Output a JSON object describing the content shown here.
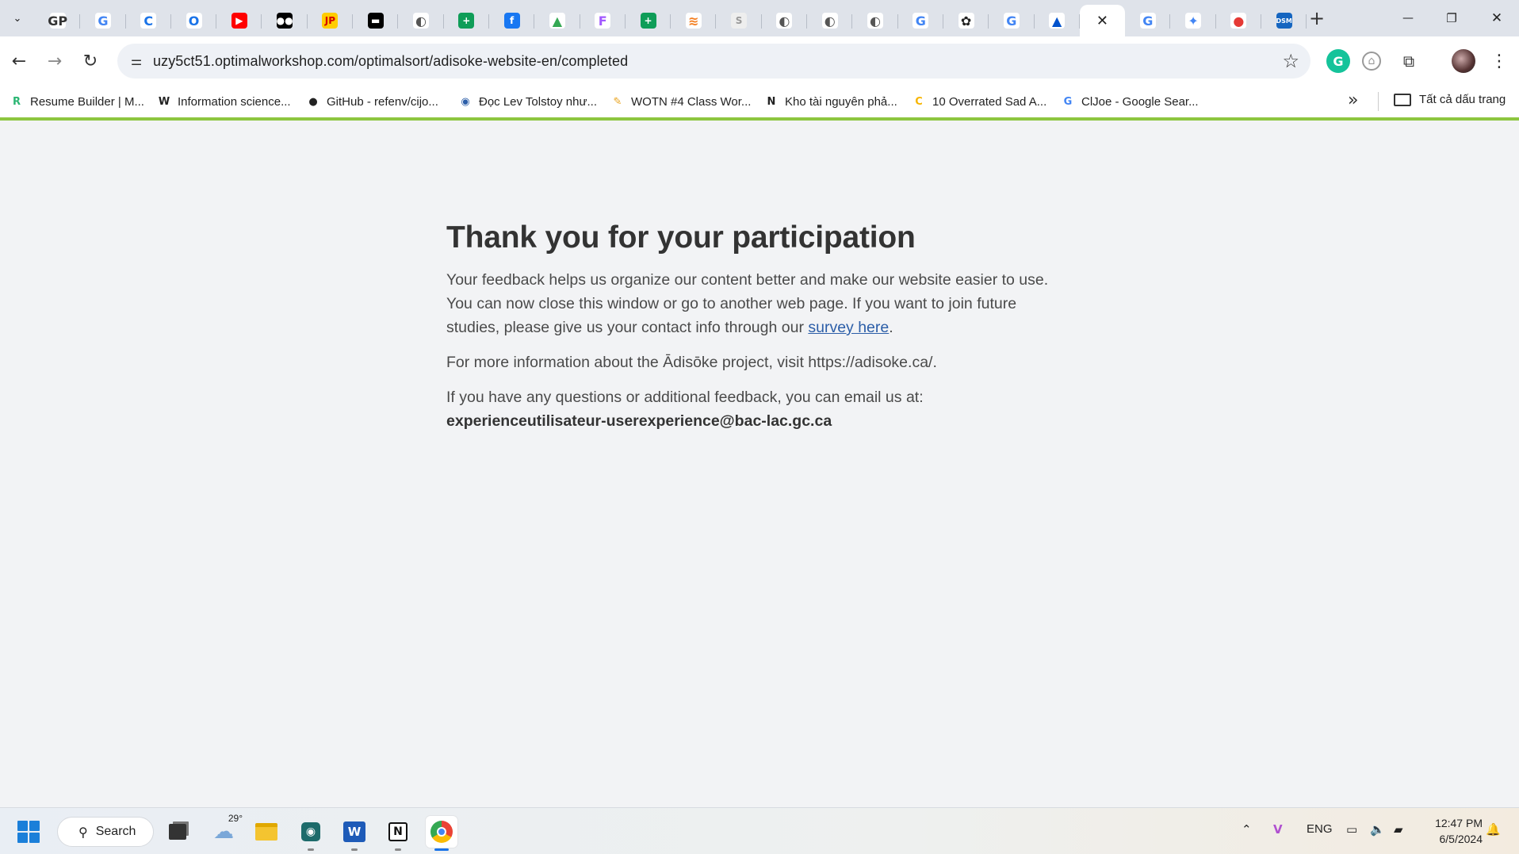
{
  "browser": {
    "tabs": [
      {
        "icon": "game-icon",
        "label": "GP",
        "bg": "#ffffff",
        "fg": "#333333"
      },
      {
        "icon": "google-icon",
        "label": "G",
        "bg": "#ffffff",
        "fg": "#4285f4"
      },
      {
        "icon": "copilot-icon",
        "label": "C",
        "bg": "#ffffff",
        "fg": "#1a73e8"
      },
      {
        "icon": "circle-o-icon",
        "label": "O",
        "bg": "#ffffff",
        "fg": "#1a73e8"
      },
      {
        "icon": "youtube-icon",
        "label": "▶",
        "bg": "#ff0000",
        "fg": "#ffffff"
      },
      {
        "icon": "medium-icon",
        "label": "●●",
        "bg": "#000000",
        "fg": "#ffffff"
      },
      {
        "icon": "jp-icon",
        "label": "JP",
        "bg": "#ffcc00",
        "fg": "#d40000"
      },
      {
        "icon": "terminal-icon",
        "label": "▬",
        "bg": "#000000",
        "fg": "#ffffff"
      },
      {
        "icon": "globe-icon",
        "label": "◐",
        "bg": "#ffffff",
        "fg": "#555555"
      },
      {
        "icon": "sheets-icon",
        "label": "+",
        "bg": "#0f9d58",
        "fg": "#ffffff"
      },
      {
        "icon": "facebook-icon",
        "label": "f",
        "bg": "#1877f2",
        "fg": "#ffffff"
      },
      {
        "icon": "drive-icon",
        "label": "▲",
        "bg": "#ffffff",
        "fg": "#34a853"
      },
      {
        "icon": "figma-icon",
        "label": "F",
        "bg": "#ffffff",
        "fg": "#a259ff"
      },
      {
        "icon": "sheets-icon",
        "label": "+",
        "bg": "#0f9d58",
        "fg": "#ffffff"
      },
      {
        "icon": "stackoverflow-icon",
        "label": "≋",
        "bg": "#ffffff",
        "fg": "#f48024"
      },
      {
        "icon": "document-icon",
        "label": "S",
        "bg": "#eeeeee",
        "fg": "#999999"
      },
      {
        "icon": "globe-icon",
        "label": "◐",
        "bg": "#ffffff",
        "fg": "#555555"
      },
      {
        "icon": "globe-icon",
        "label": "◐",
        "bg": "#ffffff",
        "fg": "#555555"
      },
      {
        "icon": "globe-icon",
        "label": "◐",
        "bg": "#ffffff",
        "fg": "#555555"
      },
      {
        "icon": "google-icon",
        "label": "G",
        "bg": "#ffffff",
        "fg": "#4285f4"
      },
      {
        "icon": "chatgpt-icon",
        "label": "✿",
        "bg": "#ffffff",
        "fg": "#222222"
      },
      {
        "icon": "google-icon",
        "label": "G",
        "bg": "#ffffff",
        "fg": "#4285f4"
      },
      {
        "icon": "atlassian-icon",
        "label": "▲",
        "bg": "#ffffff",
        "fg": "#0052cc"
      },
      {
        "icon": "close-icon",
        "label": "✕",
        "bg": "#ffffff",
        "fg": "#222222",
        "active": true
      },
      {
        "icon": "google-icon",
        "label": "G",
        "bg": "#ffffff",
        "fg": "#4285f4"
      },
      {
        "icon": "gemini-icon",
        "label": "✦",
        "bg": "#ffffff",
        "fg": "#4285f4"
      },
      {
        "icon": "notification-icon",
        "label": "●",
        "bg": "#ffffff",
        "fg": "#e53935"
      },
      {
        "icon": "dsm-icon",
        "label": "DSM",
        "bg": "#1565c0",
        "fg": "#ffffff"
      }
    ],
    "new_tab_label": "+",
    "window_controls": {
      "minimize": "—",
      "restore": "❐",
      "close": "✕"
    },
    "nav": {
      "back": "←",
      "forward": "→",
      "reload": "↻"
    },
    "url": "uzy5ct51.optimalworkshop.com/optimalsort/adisoke-website-en/completed",
    "site_info_icon": "⚌",
    "bookmark_star": "☆",
    "toolbar_icons": {
      "grammarly": "G",
      "extension1": "⌂",
      "extensions": "⧉",
      "menu": "⋮"
    },
    "bookmarks": [
      {
        "icon": "resume-icon",
        "glyph": "R",
        "color": "#2bb673",
        "label": "Resume Builder | M..."
      },
      {
        "icon": "wikipedia-icon",
        "glyph": "W",
        "color": "#222222",
        "label": "Information science..."
      },
      {
        "icon": "github-icon",
        "glyph": "●",
        "color": "#222222",
        "label": "GitHub - refenv/cijo..."
      },
      {
        "icon": "site-icon",
        "glyph": "◉",
        "color": "#2c5ea8",
        "label": "Đọc Lev Tolstoy như..."
      },
      {
        "icon": "pen-icon",
        "glyph": "✎",
        "color": "#e9a21b",
        "label": "WOTN #4 Class Wor..."
      },
      {
        "icon": "notion-icon",
        "glyph": "N",
        "color": "#222222",
        "label": "Kho tài nguyên phả..."
      },
      {
        "icon": "c-icon",
        "glyph": "C",
        "color": "#f7b500",
        "label": "10 Overrated Sad A..."
      },
      {
        "icon": "google-icon",
        "glyph": "G",
        "color": "#4285f4",
        "label": "ClJoe - Google Sear..."
      }
    ],
    "bookmarks_more": "»",
    "all_bookmarks_label": "Tất cả dấu trang"
  },
  "page": {
    "title": "Thank you for your participation",
    "para1_text": "Your feedback helps us organize our content better and make our website easier to use. You can now close this window or go to another web page. If you want to join future studies, please give us your contact info through our ",
    "para1_link": "survey here",
    "para1_end": ".",
    "para2": "For more information about the Ādisōke project, visit https://adisoke.ca/.",
    "para3": "If you have any questions or additional feedback, you can email us at:",
    "email": "experienceutilisateur-userexperience@bac-lac.gc.ca"
  },
  "taskbar": {
    "search_label": "Search",
    "weather_temp": "29°",
    "language": "ENG",
    "time": "12:47 PM",
    "date": "6/5/2024"
  },
  "colors": {
    "accent_line": "#8dc63f",
    "link": "#2c5ea8",
    "page_bg": "#f2f3f5"
  }
}
